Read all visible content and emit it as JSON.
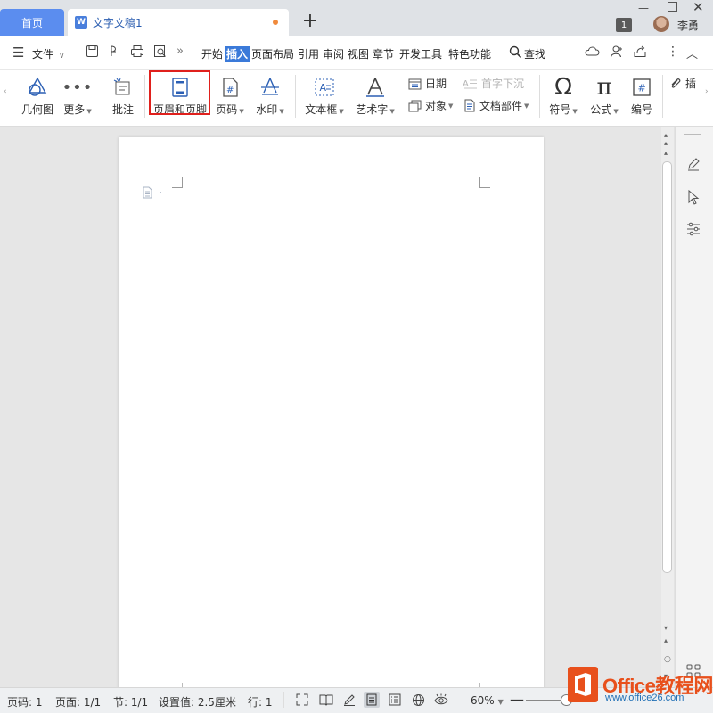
{
  "titlebar": {
    "home_tab": "首页",
    "doc_tab": "文字文稿1",
    "doc_icon_letter": "W",
    "new_tab": "+",
    "badge": "1",
    "username": "李勇"
  },
  "menubar": {
    "file_menu": "文件",
    "tabs": [
      "开始",
      "插入",
      "页面布局",
      "引用",
      "审阅",
      "视图",
      "章节",
      "开发工具",
      "特色功能"
    ],
    "active_tab": "插入",
    "search": "查找"
  },
  "ribbon": {
    "shapes": "几何图",
    "more": "更多",
    "comment": "批注",
    "header_footer": "页眉和页脚",
    "page_number": "页码",
    "watermark": "水印",
    "textbox": "文本框",
    "wordart": "艺术字",
    "date": "日期",
    "object": "对象",
    "drop_cap": "首字下沉",
    "doc_parts": "文档部件",
    "symbol": "符号",
    "formula": "公式",
    "numbering": "编号",
    "attach": "插"
  },
  "statusbar": {
    "page_num": "页码: 1",
    "pages": "页面: 1/1",
    "section": "节: 1/1",
    "setting": "设置值: 2.5厘米",
    "line": "行: 1",
    "zoom": "60%"
  },
  "watermark_logo": {
    "brand": "Office教程网",
    "url": "www.office26.com"
  },
  "colors": {
    "accent": "#3b7ad9",
    "home_tab": "#5b8def",
    "highlight": "#e0201c",
    "watermark_orange": "#e8501c",
    "watermark_blue": "#1f6fb5"
  }
}
